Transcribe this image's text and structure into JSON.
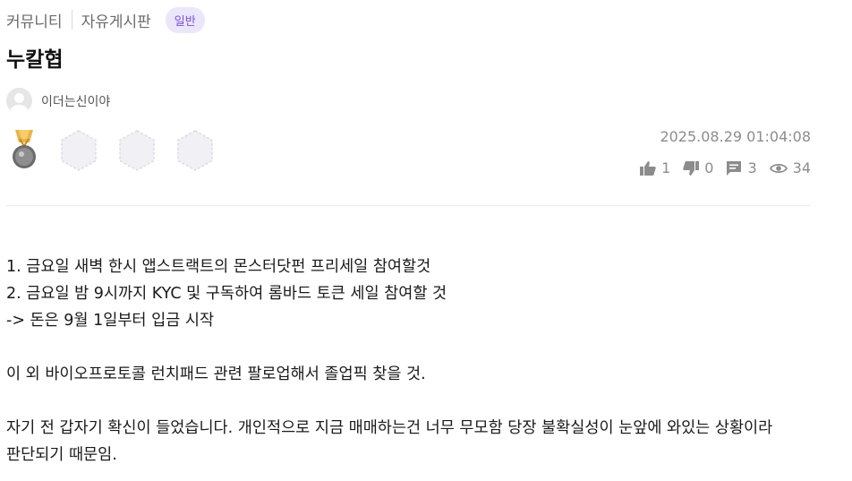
{
  "breadcrumb": {
    "community": "커뮤니티",
    "board": "자유게시판",
    "category": "일반"
  },
  "post": {
    "title": "누칼협",
    "author": "이더는신이야",
    "datetime": "2025.08.29 01:04:08",
    "stats": {
      "likes": "1",
      "dislikes": "0",
      "comments": "3",
      "views": "34"
    },
    "body": {
      "line1": "1. 금요일 새벽 한시 앱스트랙트의 몬스터닷펀 프리세일 참여할것",
      "line2": "2. 금요일 밤 9시까지 KYC 및 구독하여 롬바드 토큰 세일 참여할 것",
      "line3": "-> 돈은 9월 1일부터 입금 시작",
      "line4": "이 외 바이오프로토콜 런치패드 관련 팔로업해서 졸업픽 찾을 것.",
      "line5": "자기 전 갑자기 확신이 들었습니다. 개인적으로 지금 매매하는건 너무 무모함 당장 불확실성이 눈앞에 와있는 상황이라",
      "line6": "판단되기 때문임."
    }
  },
  "icons": {
    "like": "thumbs-up-icon",
    "dislike": "thumbs-down-icon",
    "comment": "comment-icon",
    "view": "eye-icon",
    "medal": "medal-icon"
  },
  "colors": {
    "accent": "#7b4fd6",
    "badge_bg": "#ece6fb",
    "muted": "#8c8c8c"
  }
}
